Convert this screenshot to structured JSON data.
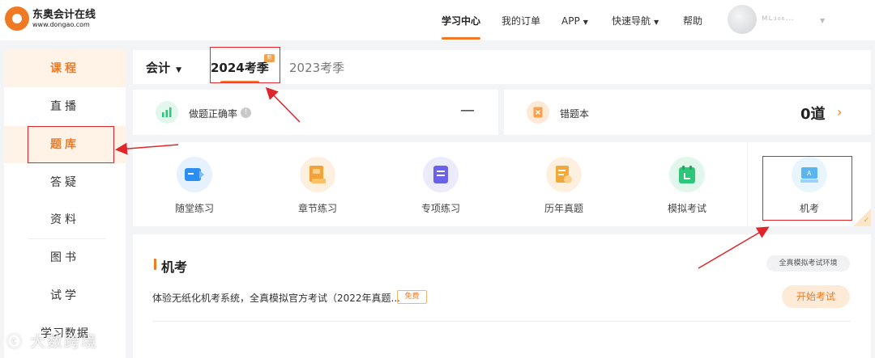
{
  "header": {
    "logo_name": "东奥会计在线",
    "logo_url": "www.dongao.com",
    "nav": [
      {
        "label": "学习中心"
      },
      {
        "label": "我的订单"
      },
      {
        "label": "APP"
      },
      {
        "label": "快速导航"
      },
      {
        "label": "帮助"
      }
    ],
    "username": "ᴍʟ₃₀₆…"
  },
  "sidebar": {
    "items": [
      {
        "label": "课程"
      },
      {
        "label": "直播"
      },
      {
        "label": "题库"
      },
      {
        "label": "答疑"
      },
      {
        "label": "资料"
      },
      {
        "label": "图书"
      },
      {
        "label": "试学"
      },
      {
        "label": "学习数据"
      }
    ]
  },
  "tabs": {
    "subject": "会计",
    "active": "2024考季",
    "inactive": "2023考季",
    "new_badge": "新"
  },
  "stats": {
    "accuracy_label": "做题正确率",
    "accuracy_info": "!",
    "accuracy_value": "—",
    "wrongbook_label": "错题本",
    "wrongbook_value": "0道"
  },
  "practice": {
    "items": [
      {
        "label": "随堂练习",
        "color": "#2b8ef3"
      },
      {
        "label": "章节练习",
        "color": "#f3a23a"
      },
      {
        "label": "专项练习",
        "color": "#6a62e8"
      },
      {
        "label": "历年真题",
        "color": "#f2a93b"
      },
      {
        "label": "模拟考试",
        "color": "#2ec77a"
      },
      {
        "label": "机考",
        "color": "#5ab4f0"
      }
    ],
    "selected": "机考"
  },
  "exam_panel": {
    "title": "机考",
    "env_tag": "全真模拟考试环境",
    "description": "体验无纸化机考系统，全真模拟官方考试（2022年真题...",
    "free_badge": "免费",
    "start_button": "开始考试"
  },
  "watermark": "大数跨境",
  "colors": {
    "accent": "#f07a24",
    "annotation_red": "#e0262b"
  }
}
